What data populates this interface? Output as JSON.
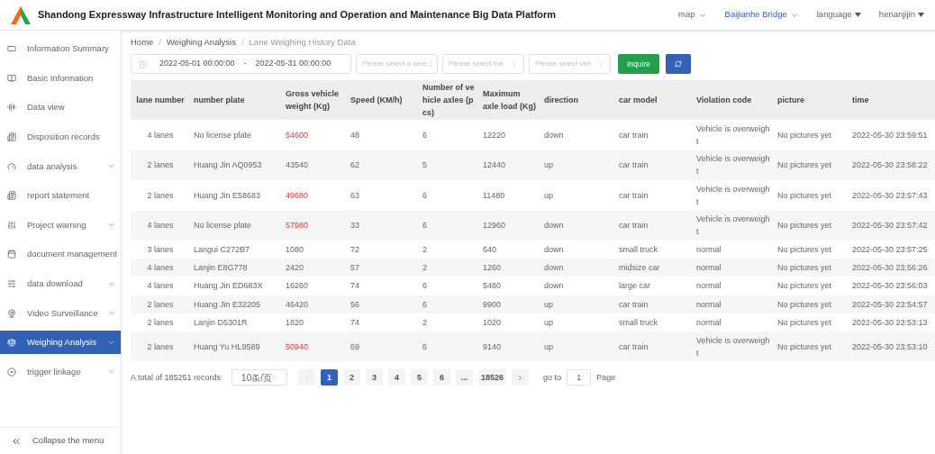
{
  "header": {
    "title": "Shandong Expressway Infrastructure Intelligent Monitoring and Operation and Maintenance Big Data Platform",
    "menus": [
      {
        "label": "map",
        "kind": "chevron",
        "selected": false
      },
      {
        "label": "Baijianhe Bridge",
        "kind": "chevron",
        "selected": true
      },
      {
        "label": "language",
        "kind": "caret",
        "selected": false
      },
      {
        "label": "henanjijin",
        "kind": "caret",
        "selected": false
      }
    ]
  },
  "sidebar": {
    "items": [
      {
        "label": "Information Summary",
        "expandable": false,
        "selected": false
      },
      {
        "label": "Basic Information",
        "expandable": false,
        "selected": false
      },
      {
        "label": "Data view",
        "expandable": false,
        "selected": false
      },
      {
        "label": "Disposition records",
        "expandable": false,
        "selected": false
      },
      {
        "label": "data analysis",
        "expandable": true,
        "selected": false
      },
      {
        "label": "report statement",
        "expandable": false,
        "selected": false
      },
      {
        "label": "Project warning",
        "expandable": true,
        "selected": false
      },
      {
        "label": "document management",
        "expandable": false,
        "selected": false
      },
      {
        "label": "data download",
        "expandable": true,
        "selected": false
      },
      {
        "label": "Video Surveillance",
        "expandable": true,
        "selected": false
      },
      {
        "label": "Weighing Analysis",
        "expandable": true,
        "selected": true
      },
      {
        "label": "trigger linkage",
        "expandable": true,
        "selected": false
      }
    ],
    "collapse": "Collapse the menu"
  },
  "breadcrumb": [
    {
      "label": "Home"
    },
    {
      "separator": "/",
      "label": "Weighing Analysis"
    },
    {
      "separator": "/",
      "label": "Lane Weighing History Data"
    }
  ],
  "filters": {
    "date_start": "2022-05-01 00:00:00",
    "date_separator": "-",
    "date_end": "2022-05-31 00:00:00",
    "selects": [
      {
        "placeholder": "Please select a lane"
      },
      {
        "placeholder": "Please select the"
      },
      {
        "placeholder": "Please select veh"
      }
    ],
    "inquire": "Inquire"
  },
  "table": {
    "columns": [
      "lane number",
      "number plate",
      "Gross vehicle weight (Kg)",
      "Speed (KM/h)",
      "Number of vehicle axles (pcs)",
      "Maximum axle load (Kg)",
      "direction",
      "car model",
      "Violation code",
      "picture",
      "time"
    ],
    "rows": [
      {
        "cells": [
          "4 lanes",
          "No license plate",
          "54600",
          "48",
          "6",
          "12220",
          "down",
          "car train",
          "Vehicle is overweight",
          "No pictures yet",
          "2022-05-30 23:59:51"
        ],
        "weight_alert": true
      },
      {
        "cells": [
          "2 lanes",
          "Huang Jin AQ0953",
          "43540",
          "62",
          "5",
          "12440",
          "up",
          "car train",
          "Vehicle is overweight",
          "No pictures yet",
          "2022-05-30 23:58:22"
        ],
        "weight_alert": false
      },
      {
        "cells": [
          "2 lanes",
          "Huang Jin E58683",
          "49680",
          "63",
          "6",
          "11480",
          "up",
          "car train",
          "Vehicle is overweight",
          "No pictures yet",
          "2022-05-30 23:57:43"
        ],
        "weight_alert": true
      },
      {
        "cells": [
          "4 lanes",
          "No license plate",
          "57980",
          "33",
          "6",
          "12960",
          "down",
          "car train",
          "Vehicle is overweight",
          "No pictures yet",
          "2022-05-30 23:57:42"
        ],
        "weight_alert": true
      },
      {
        "cells": [
          "3 lanes",
          "Langui C272B7",
          "1080",
          "72",
          "2",
          "640",
          "down",
          "small truck",
          "normal",
          "No pictures yet",
          "2022-05-30 23:57:25"
        ],
        "weight_alert": false
      },
      {
        "cells": [
          "4 lanes",
          "Lanjin E8G778",
          "2420",
          "57",
          "2",
          "1260",
          "down",
          "midsize car",
          "normal",
          "No pictures yet",
          "2022-05-30 23:56:26"
        ],
        "weight_alert": false
      },
      {
        "cells": [
          "4 lanes",
          "Huang Jin ED683X",
          "16260",
          "74",
          "6",
          "5480",
          "down",
          "large car",
          "normal",
          "No pictures yet",
          "2022-05-30 23:56:03"
        ],
        "weight_alert": false
      },
      {
        "cells": [
          "2 lanes",
          "Huang Jin E32205",
          "46420",
          "56",
          "6",
          "9900",
          "up",
          "car train",
          "normal",
          "No pictures yet",
          "2022-05-30 23:54:57"
        ],
        "weight_alert": false
      },
      {
        "cells": [
          "2 lanes",
          "Lanjin D5301R",
          "1820",
          "74",
          "2",
          "1020",
          "up",
          "small truck",
          "normal",
          "No pictures yet",
          "2022-05-30 23:53:13"
        ],
        "weight_alert": false
      },
      {
        "cells": [
          "2 lanes",
          "Huang Yu HL9589",
          "50940",
          "69",
          "6",
          "9140",
          "up",
          "car train",
          "Vehicle is overweight",
          "No pictures yet",
          "2022-05-30 23:53:10"
        ],
        "weight_alert": true
      }
    ]
  },
  "pagination": {
    "total": "A total of 185251 records",
    "page_size": "10条/页",
    "pages": [
      {
        "label": "1",
        "selected": true
      },
      {
        "label": "2",
        "selected": false
      },
      {
        "label": "3",
        "selected": false
      },
      {
        "label": "4",
        "selected": false
      },
      {
        "label": "5",
        "selected": false
      },
      {
        "label": "6",
        "selected": false
      },
      {
        "label": "...",
        "selected": false
      },
      {
        "label": "18526",
        "selected": false
      }
    ],
    "goto": "go to",
    "goto_value": "1",
    "page_word": "Page"
  }
}
